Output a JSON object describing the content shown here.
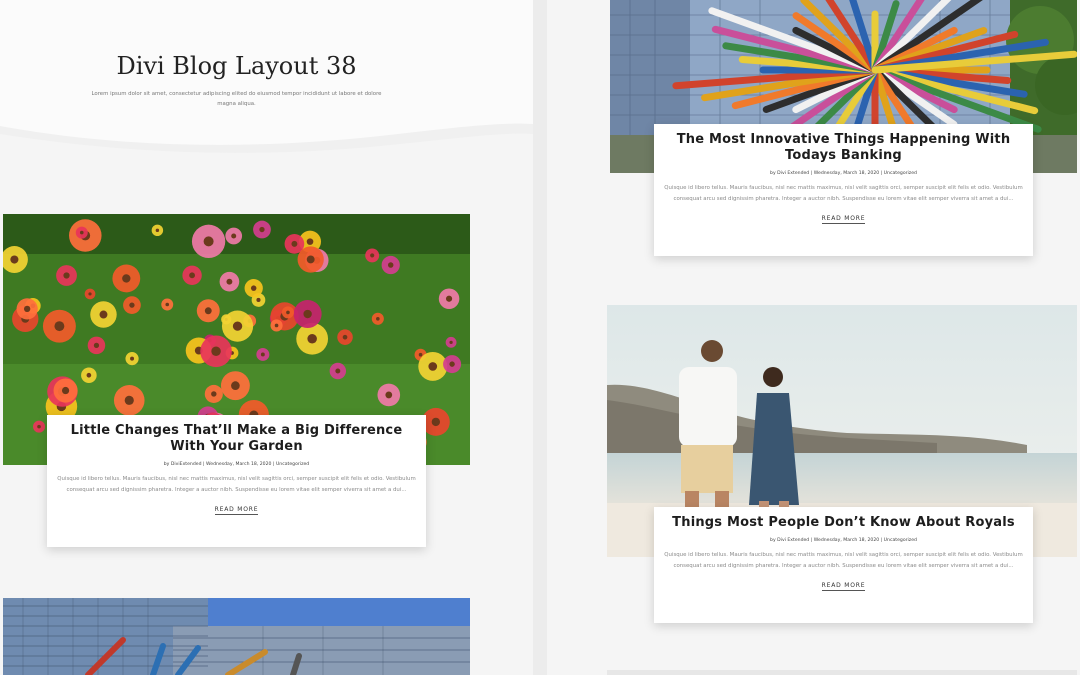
{
  "page": {
    "title": "Divi Blog Layout 38",
    "tagline": "Lorem ipsum dolor sit amet, consectetur adipiscing elited do eiusmod tempor incididunt ut labore et dolore magna aliqua."
  },
  "posts": [
    {
      "title": "Little Changes That’ll Make a Big Difference With Your Garden",
      "author": "DiviExtended",
      "date": "Wednesday, March 18, 2020",
      "category": "Uncategorized",
      "excerpt": "Quisque id libero tellus. Mauris faucibus, nisl nec mattis maximus, nisl velit sagittis orci, semper suscipit elit felis et odio. Vestibulum consequat arcu sed dignissim pharetra. Integer a auctor nibh. Suspendisse eu lorem vitae elit semper viverra sit amet a dui...",
      "read_more": "READ MORE"
    },
    {
      "title": "The Most Innovative Things Happening With Todays Banking",
      "author": "Divi Extended",
      "date": "Wednesday, March 18, 2020",
      "category": "Uncategorized",
      "excerpt": "Quisque id libero tellus. Mauris faucibus, nisl nec mattis maximus, nisl velit sagittis orci, semper suscipit elit felis et odio. Vestibulum consequat arcu sed dignissim pharetra. Integer a auctor nibh. Suspendisse eu lorem vitae elit semper viverra sit amet a dui...",
      "read_more": "READ MORE"
    },
    {
      "title": "Things Most People Don’t Know About Royals",
      "author": "Divi Extended",
      "date": "Wednesday, March 18, 2020",
      "category": "Uncategorized",
      "excerpt": "Quisque id libero tellus. Mauris faucibus, nisl nec mattis maximus, nisl velit sagittis orci, semper suscipit elit felis et odio. Vestibulum consequat arcu sed dignissim pharetra. Integer a auctor nibh. Suspendisse eu lorem vitae elit semper viverra sit amet a dui...",
      "read_more": "READ MORE"
    }
  ],
  "meta_by": "by",
  "meta_sep": "|",
  "colors": {
    "page_bg": "#f5f5f5",
    "card_bg": "#ffffff",
    "title": "#1d1d1d",
    "excerpt": "#8a8a8a"
  }
}
